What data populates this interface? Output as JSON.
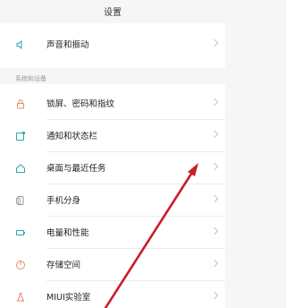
{
  "header": {
    "title": "设置"
  },
  "top_group": {
    "items": [
      {
        "label": "声音和振动",
        "icon": "speaker-icon"
      }
    ]
  },
  "system_section": {
    "title": "系统和设备",
    "items": [
      {
        "label": "锁屏、密码和指纹",
        "icon": "lock-icon"
      },
      {
        "label": "通知和状态栏",
        "icon": "notification-icon"
      },
      {
        "label": "桌面与最近任务",
        "icon": "home-icon"
      },
      {
        "label": "手机分身",
        "icon": "dual-phone-icon"
      },
      {
        "label": "电量和性能",
        "icon": "battery-icon"
      },
      {
        "label": "存储空间",
        "icon": "storage-icon"
      },
      {
        "label": "MIUI实验室",
        "icon": "lab-icon"
      }
    ]
  },
  "colors": {
    "icon_accent": "#e58a6a",
    "icon_teal": "#2aa7a1",
    "annotation": "#c81e2d"
  }
}
